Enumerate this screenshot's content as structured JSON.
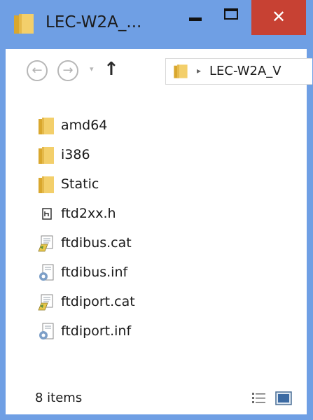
{
  "window": {
    "title": "LEC-W2A_...",
    "close_glyph": "✕",
    "accent_color": "#6F9FE4",
    "close_color": "#C74133"
  },
  "nav": {
    "back_glyph": "←",
    "forward_glyph": "→",
    "dropdown_glyph": "▾",
    "up_glyph": "↑",
    "breadcrumb_sep": "▸",
    "address_text": "LEC-W2A_V"
  },
  "files": [
    {
      "name": "amd64",
      "icon": "folder-icon"
    },
    {
      "name": "i386",
      "icon": "folder-icon"
    },
    {
      "name": "Static",
      "icon": "folder-icon"
    },
    {
      "name": "ftd2xx.h",
      "icon": "header-file-icon"
    },
    {
      "name": "ftdibus.cat",
      "icon": "security-catalog-icon"
    },
    {
      "name": "ftdibus.inf",
      "icon": "setup-info-icon"
    },
    {
      "name": "ftdiport.cat",
      "icon": "security-catalog-icon"
    },
    {
      "name": "ftdiport.inf",
      "icon": "setup-info-icon"
    }
  ],
  "status": {
    "item_count": "8 items"
  }
}
